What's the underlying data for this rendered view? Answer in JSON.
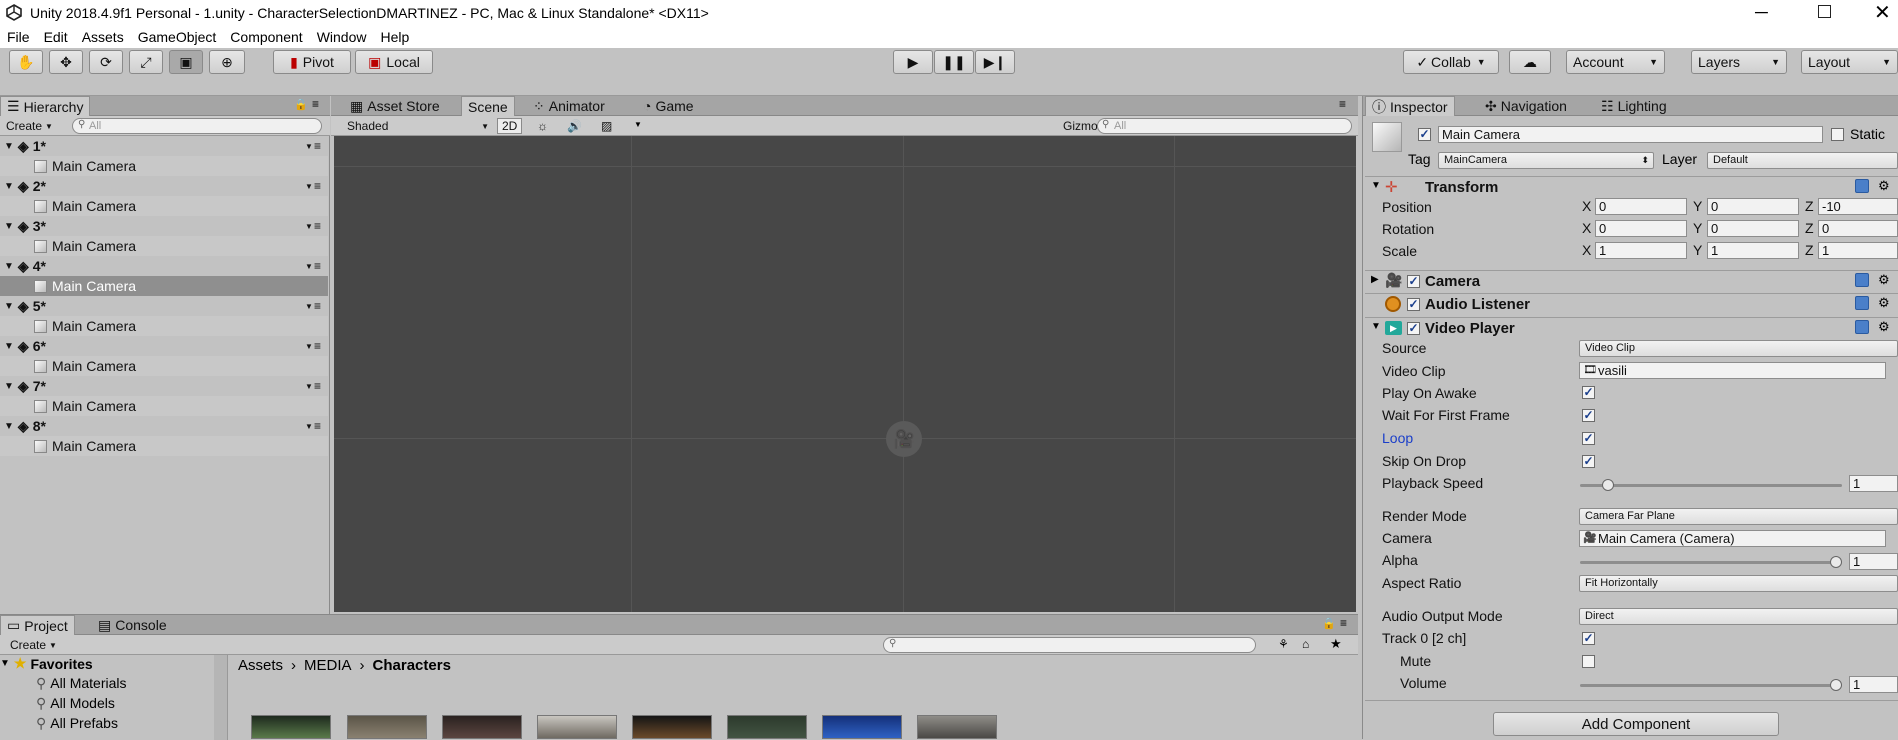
{
  "window": {
    "title": "Unity 2018.4.9f1 Personal - 1.unity - CharacterSelectionDMARTINEZ - PC, Mac & Linux Standalone* <DX11>",
    "controls": [
      "minimize",
      "maximize",
      "close"
    ]
  },
  "menu": [
    "File",
    "Edit",
    "Assets",
    "GameObject",
    "Component",
    "Window",
    "Help"
  ],
  "toolbar": {
    "pivot_label": "Pivot",
    "local_label": "Local",
    "collab_label": "Collab",
    "account_label": "Account",
    "layers_label": "Layers",
    "layout_label": "Layout"
  },
  "hierarchy": {
    "tab_label": "Hierarchy",
    "create_label": "Create",
    "search_placeholder": "All",
    "scenes": [
      {
        "name": "1*",
        "child": "Main Camera"
      },
      {
        "name": "2*",
        "child": "Main Camera"
      },
      {
        "name": "3*",
        "child": "Main Camera"
      },
      {
        "name": "4*",
        "child": "Main Camera"
      },
      {
        "name": "5*",
        "child": "Main Camera"
      },
      {
        "name": "6*",
        "child": "Main Camera"
      },
      {
        "name": "7*",
        "child": "Main Camera"
      },
      {
        "name": "8*",
        "child": "Main Camera"
      }
    ]
  },
  "center_tabs": {
    "asset_store": "Asset Store",
    "scene": "Scene",
    "animator": "Animator",
    "game": "Game"
  },
  "scene_bar": {
    "shading_mode": "Shaded",
    "mode_2d": "2D",
    "gizmos_label": "Gizmos",
    "search_placeholder": "All"
  },
  "bottom": {
    "project_tab": "Project",
    "console_tab": "Console",
    "create_label": "Create",
    "favorites_label": "Favorites",
    "favorites": [
      "All Materials",
      "All Models",
      "All Prefabs"
    ],
    "breadcrumb": [
      "Assets",
      "MEDIA",
      "Characters"
    ]
  },
  "inspector": {
    "tabs": {
      "inspector": "Inspector",
      "navigation": "Navigation",
      "lighting": "Lighting"
    },
    "object_name": "Main Camera",
    "static_label": "Static",
    "tag_label": "Tag",
    "tag_value": "MainCamera",
    "layer_label": "Layer",
    "layer_value": "Default",
    "transform": {
      "title": "Transform",
      "position_label": "Position",
      "rotation_label": "Rotation",
      "scale_label": "Scale",
      "position": {
        "x": "0",
        "y": "0",
        "z": "-10"
      },
      "rotation": {
        "x": "0",
        "y": "0",
        "z": "0"
      },
      "scale": {
        "x": "1",
        "y": "1",
        "z": "1"
      }
    },
    "axis": {
      "x": "X",
      "y": "Y",
      "z": "Z"
    },
    "camera_title": "Camera",
    "audio_listener_title": "Audio Listener",
    "video_player": {
      "title": "Video Player",
      "source_label": "Source",
      "source_value": "Video Clip",
      "video_clip_label": "Video Clip",
      "video_clip_value": "vasili",
      "play_on_awake_label": "Play On Awake",
      "wait_first_frame_label": "Wait For First Frame",
      "loop_label": "Loop",
      "skip_on_drop_label": "Skip On Drop",
      "playback_speed_label": "Playback Speed",
      "playback_speed_value": "1",
      "render_mode_label": "Render Mode",
      "render_mode_value": "Camera Far Plane",
      "camera_label": "Camera",
      "camera_value": "Main Camera (Camera)",
      "alpha_label": "Alpha",
      "alpha_value": "1",
      "aspect_ratio_label": "Aspect Ratio",
      "aspect_ratio_value": "Fit Horizontally",
      "audio_output_label": "Audio Output Mode",
      "audio_output_value": "Direct",
      "track_label": "Track 0 [2 ch]",
      "mute_label": "Mute",
      "volume_label": "Volume",
      "volume_value": "1"
    },
    "add_component_label": "Add Component"
  },
  "colors": {
    "panel_bg": "#c2c2c2",
    "scene_bg": "#474747",
    "selection": "#8f8f8f",
    "link_blue": "#1a3ec9"
  }
}
